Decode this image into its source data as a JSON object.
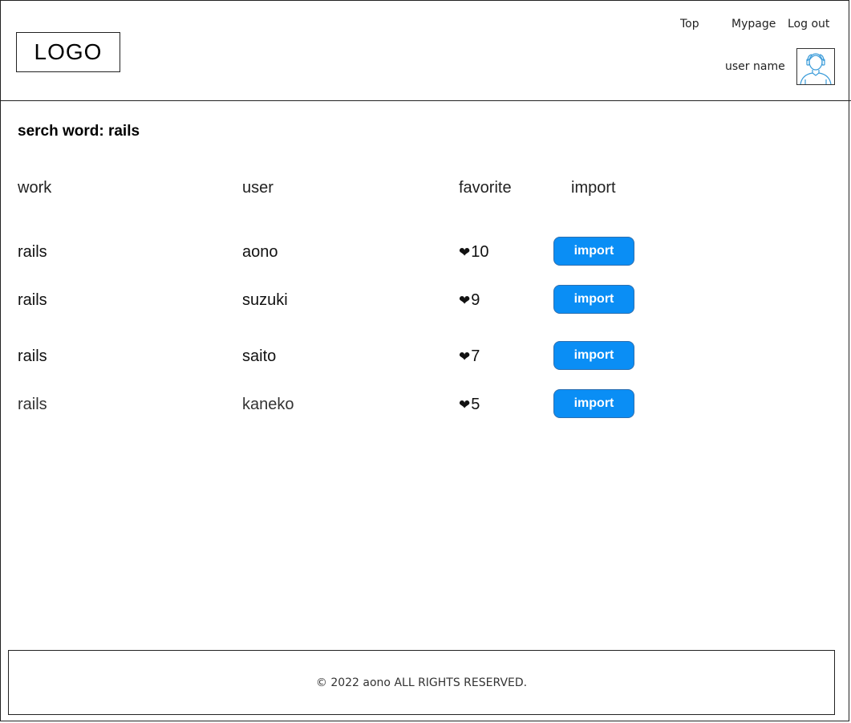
{
  "header": {
    "logo": "LOGO",
    "nav": [
      "Top",
      "Mypage",
      "Log out"
    ],
    "user_name": "user name",
    "avatar_icon": "user-avatar-icon"
  },
  "search": {
    "label": "serch word: rails"
  },
  "table": {
    "headers": [
      "work",
      "user",
      "favorite",
      "import"
    ],
    "rows": [
      {
        "work": "rails",
        "user": "aono",
        "favorite": "10",
        "button": "import"
      },
      {
        "work": "rails",
        "user": "suzuki",
        "favorite": "9",
        "button": "import"
      },
      {
        "work": "rails",
        "user": "saito",
        "favorite": "7",
        "button": "import"
      },
      {
        "work": "rails",
        "user": "kaneko",
        "favorite": "5",
        "button": "import"
      }
    ],
    "heart_icon": "heart-icon"
  },
  "footer": {
    "copyright": "© 2022 aono ALL RIGHTS RESERVED."
  },
  "colors": {
    "accent": "#0a8ef5",
    "avatar_stroke": "#3a9bd9"
  }
}
